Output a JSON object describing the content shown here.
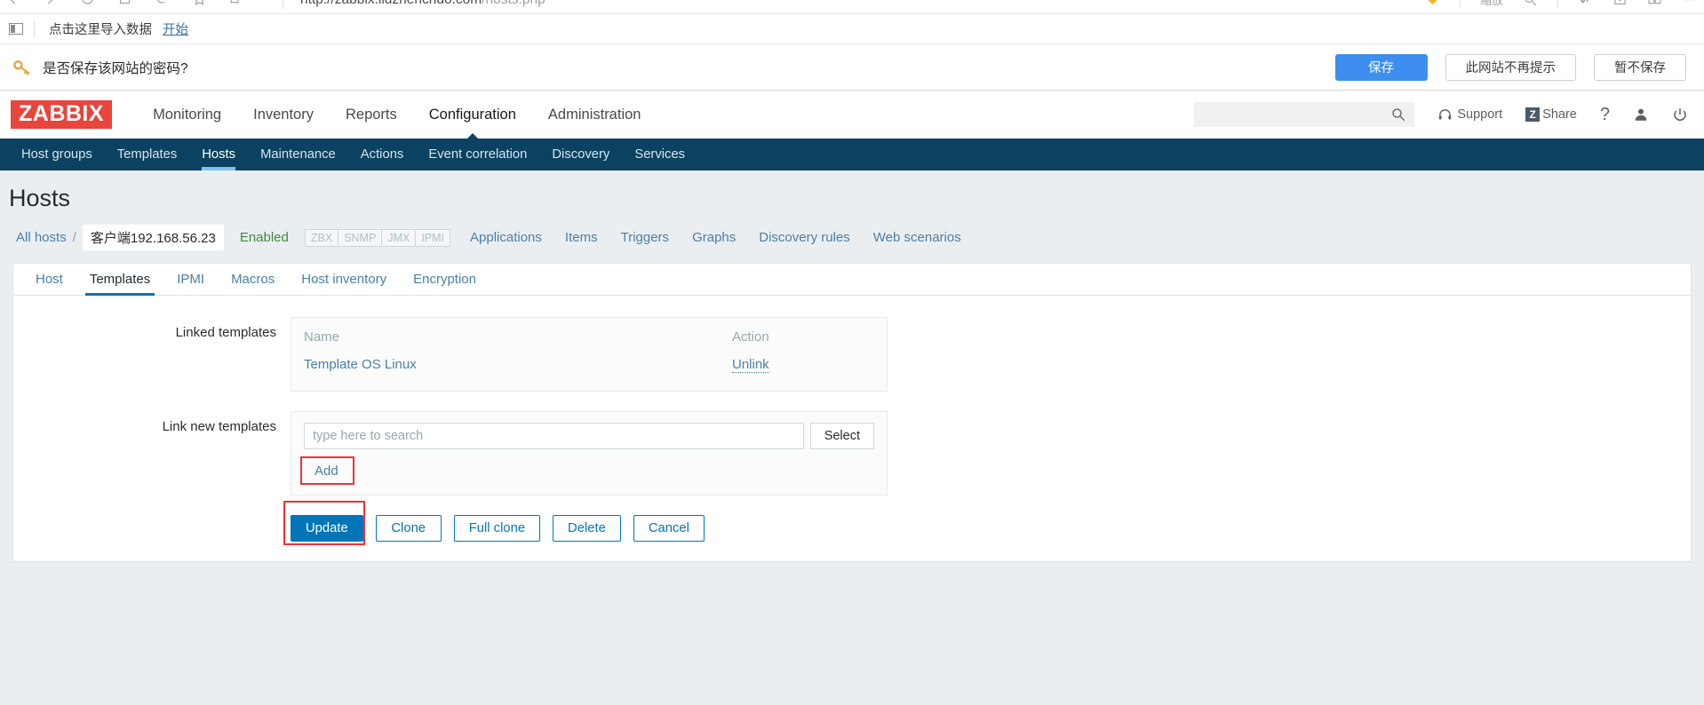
{
  "browser": {
    "url_main": "http://zabbix.lidzhenchdo.com",
    "url_path": "/hosts.php",
    "zoom_label": "缩放",
    "nav_icons": [
      "back-icon",
      "forward-icon",
      "reload-icon",
      "home-icon",
      "history-icon",
      "bookmark-icon",
      "share-icon"
    ],
    "right_icons": [
      "diamond-icon",
      "collect-icon",
      "search-icon",
      "download-icon",
      "window-icon",
      "apps-icon",
      "menu-icon"
    ]
  },
  "import_bar": {
    "panel_icon": "panel-icon",
    "text": "点击这里导入数据",
    "link": "开始"
  },
  "password_bar": {
    "icon": "key-icon",
    "message": "是否保存该网站的密码?",
    "buttons": [
      {
        "label": "保存",
        "style": "primary"
      },
      {
        "label": "此网站不再提示",
        "style": "ghost"
      },
      {
        "label": "暂不保存",
        "style": "ghost"
      }
    ]
  },
  "header": {
    "logo": "ZABBIX",
    "nav": [
      {
        "label": "Monitoring",
        "active": false
      },
      {
        "label": "Inventory",
        "active": false
      },
      {
        "label": "Reports",
        "active": false
      },
      {
        "label": "Configuration",
        "active": true
      },
      {
        "label": "Administration",
        "active": false
      }
    ],
    "search_placeholder": "",
    "search_value": "",
    "support_label": "Support",
    "share_label": "Share",
    "share_badge": "Z",
    "help_label": "?",
    "icons": [
      "search-icon",
      "headset-icon",
      "share-icon",
      "help-icon",
      "user-icon",
      "power-icon"
    ]
  },
  "subnav": [
    {
      "label": "Host groups",
      "active": false
    },
    {
      "label": "Templates",
      "active": false
    },
    {
      "label": "Hosts",
      "active": true
    },
    {
      "label": "Maintenance",
      "active": false
    },
    {
      "label": "Actions",
      "active": false
    },
    {
      "label": "Event correlation",
      "active": false
    },
    {
      "label": "Discovery",
      "active": false
    },
    {
      "label": "Services",
      "active": false
    }
  ],
  "page": {
    "title": "Hosts",
    "breadcrumb": {
      "root": "All hosts",
      "separator": "/",
      "current": "客户端192.168.56.23",
      "status": "Enabled",
      "badges": [
        "ZBX",
        "SNMP",
        "JMX",
        "IPMI"
      ],
      "tabs": [
        "Applications",
        "Items",
        "Triggers",
        "Graphs",
        "Discovery rules",
        "Web scenarios"
      ]
    },
    "form_tabs": [
      {
        "label": "Host",
        "active": false
      },
      {
        "label": "Templates",
        "active": true
      },
      {
        "label": "IPMI",
        "active": false
      },
      {
        "label": "Macros",
        "active": false
      },
      {
        "label": "Host inventory",
        "active": false
      },
      {
        "label": "Encryption",
        "active": false
      }
    ],
    "linked_templates": {
      "label": "Linked templates",
      "columns": [
        "Name",
        "Action"
      ],
      "rows": [
        {
          "name": "Template OS Linux",
          "action": "Unlink"
        }
      ]
    },
    "link_new_templates": {
      "label": "Link new templates",
      "input_placeholder": "type here to search",
      "input_value": "",
      "select_label": "Select",
      "add_label": "Add"
    },
    "form_buttons": [
      {
        "label": "Update",
        "style": "primary",
        "highlighted": true
      },
      {
        "label": "Clone",
        "style": "secondary",
        "highlighted": false
      },
      {
        "label": "Full clone",
        "style": "secondary",
        "highlighted": false
      },
      {
        "label": "Delete",
        "style": "secondary",
        "highlighted": false
      },
      {
        "label": "Cancel",
        "style": "secondary",
        "highlighted": false
      }
    ]
  },
  "colors": {
    "brand_red": "#e8453c",
    "subnav_bg": "#0b4261",
    "accent_blue": "#0275b8",
    "link_blue": "#4a7fa8",
    "status_green": "#3f8a3f",
    "highlight_red": "#ee3333",
    "page_bg": "#ebeef1"
  }
}
